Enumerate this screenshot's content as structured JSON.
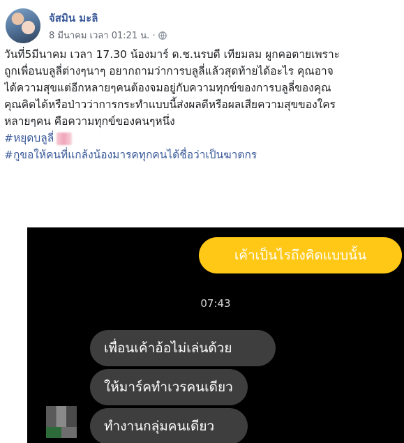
{
  "post": {
    "author": "จัสมิน มะลิ",
    "date": "8 มีนาคม เวลา 01:21 น. ·",
    "lines": [
      "วันที่5มีนาคม เวลา 17.30 น้องมาร์ ด.ช.นรบดี เทียมลม ผูกคอตายเพราะ",
      "ถูกเพื่อนบลูลี่ต่างๆนาๆ อยากถามว่าการบลูลี่แล้วสุดท้ายได้อะไร คุณอาจ",
      "ได้ความสุขแต่อีกหลายๆคนต้องจมอยู่กับความทุกข์ของการบลูลี่ของคุณ",
      "คุณคิดได้หรือป่าวว่าการกระทำแบบนี้ส่งผลดีหรือผลเสียความสุขของใคร",
      "หลายๆคน คือความทุกข์ของคนๆหนึ่ง"
    ],
    "hashtags": [
      "#หยุดบลูลี่",
      "#กูขอให้คนที่แกล้งน้องมารคทุกคนได้ชื่อว่าเป็นฆาตกร"
    ]
  },
  "chat": {
    "outgoing": "เค้าเป็นไรถึงคิดแบบนั้น",
    "time": "07:43",
    "incoming": [
      "เพื่อนเค้าอ้อไม่เล่นด้วย",
      "ให้มาร์คทำเวรคนเดียว",
      "ทำงานกลุ่มคนเดียว"
    ]
  },
  "colors": {
    "link": "#385898",
    "outgoing_bubble": "#ffc817",
    "incoming_bubble": "#3e3e3e"
  }
}
